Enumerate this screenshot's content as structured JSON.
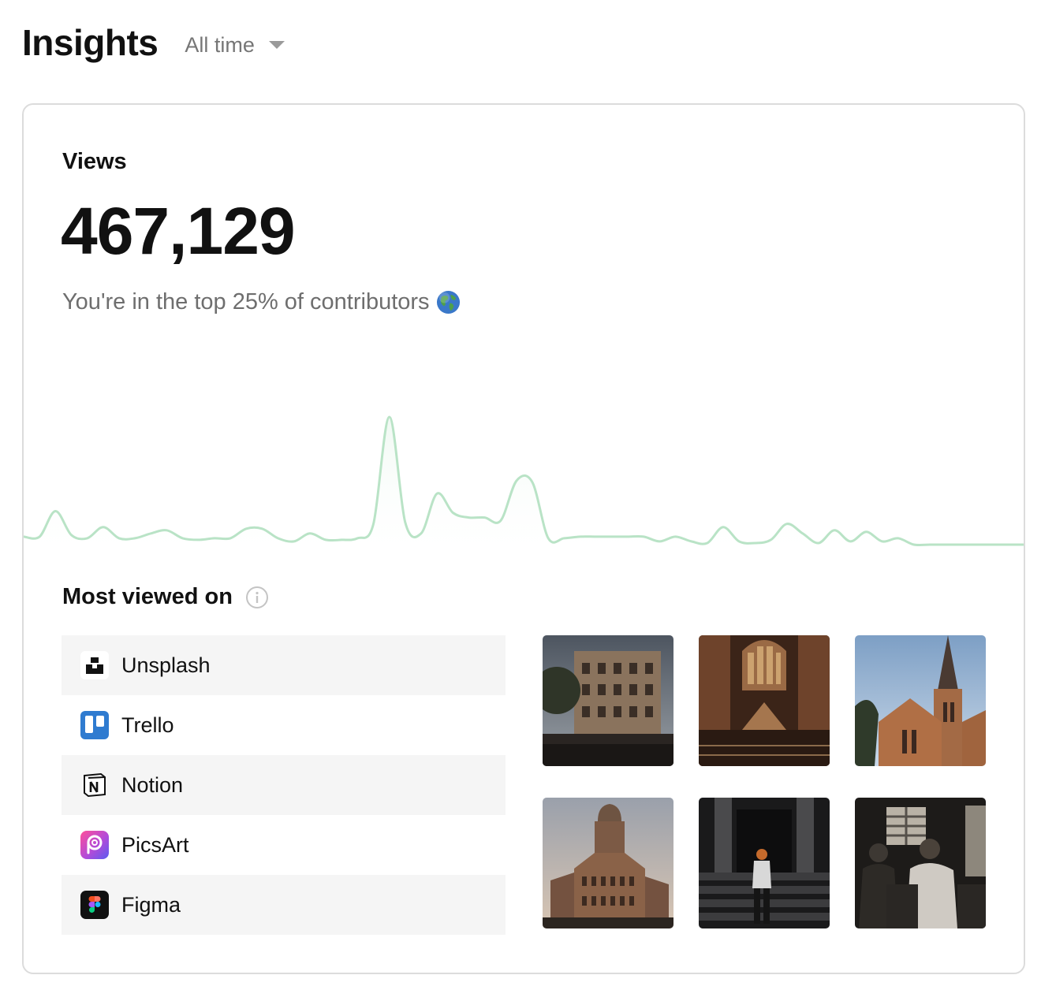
{
  "header": {
    "title": "Insights",
    "range": "All time"
  },
  "views": {
    "label": "Views",
    "total": "467,129",
    "rank_text": "You're in the top 25% of contributors"
  },
  "colors": {
    "chart_line": "#b9e3c6",
    "chart_fill": "#eef8f1",
    "row_bg": "#f5f5f5",
    "border": "#dcdcdc"
  },
  "chart_data": {
    "type": "area",
    "x": [
      0,
      1,
      2,
      3,
      4,
      5,
      6,
      7,
      8,
      9,
      10,
      11,
      12,
      13,
      14,
      15,
      16,
      17,
      18,
      19,
      20,
      21,
      22,
      23,
      24,
      25,
      26,
      27,
      28,
      29,
      30,
      31,
      32,
      33,
      34,
      35,
      36,
      37,
      38,
      39,
      40,
      41,
      42,
      43,
      44,
      45,
      46,
      47,
      48,
      49,
      50,
      51,
      52,
      53,
      54,
      55,
      56,
      57,
      58,
      59,
      60,
      61,
      62,
      63
    ],
    "values": [
      5,
      5,
      21,
      6,
      4,
      11,
      4,
      4,
      7,
      9,
      4,
      3,
      4,
      4,
      10,
      10,
      4,
      2,
      7,
      3,
      3,
      4,
      13,
      80,
      14,
      7,
      32,
      20,
      17,
      17,
      15,
      40,
      39,
      4,
      4,
      5,
      5,
      5,
      5,
      5,
      2,
      5,
      2,
      1,
      11,
      2,
      1,
      3,
      13,
      7,
      1,
      9,
      2,
      8,
      2,
      4,
      0,
      0,
      0,
      0,
      0,
      0,
      0,
      0
    ],
    "title": "",
    "xlabel": "",
    "ylabel": "",
    "grid": false,
    "legend": "none"
  },
  "most_viewed": {
    "title": "Most viewed on",
    "apps": [
      {
        "name": "Unsplash",
        "icon": "unsplash-logo"
      },
      {
        "name": "Trello",
        "icon": "trello-logo"
      },
      {
        "name": "Notion",
        "icon": "notion-logo"
      },
      {
        "name": "PicsArt",
        "icon": "picsart-logo"
      },
      {
        "name": "Figma",
        "icon": "figma-logo"
      }
    ]
  },
  "photos": [
    {
      "icon": "colonial-building-photo"
    },
    {
      "icon": "church-interior-photo"
    },
    {
      "icon": "church-spire-photo"
    },
    {
      "icon": "domed-building-photo"
    },
    {
      "icon": "person-on-steps-photo"
    },
    {
      "icon": "train-passengers-photo"
    }
  ]
}
